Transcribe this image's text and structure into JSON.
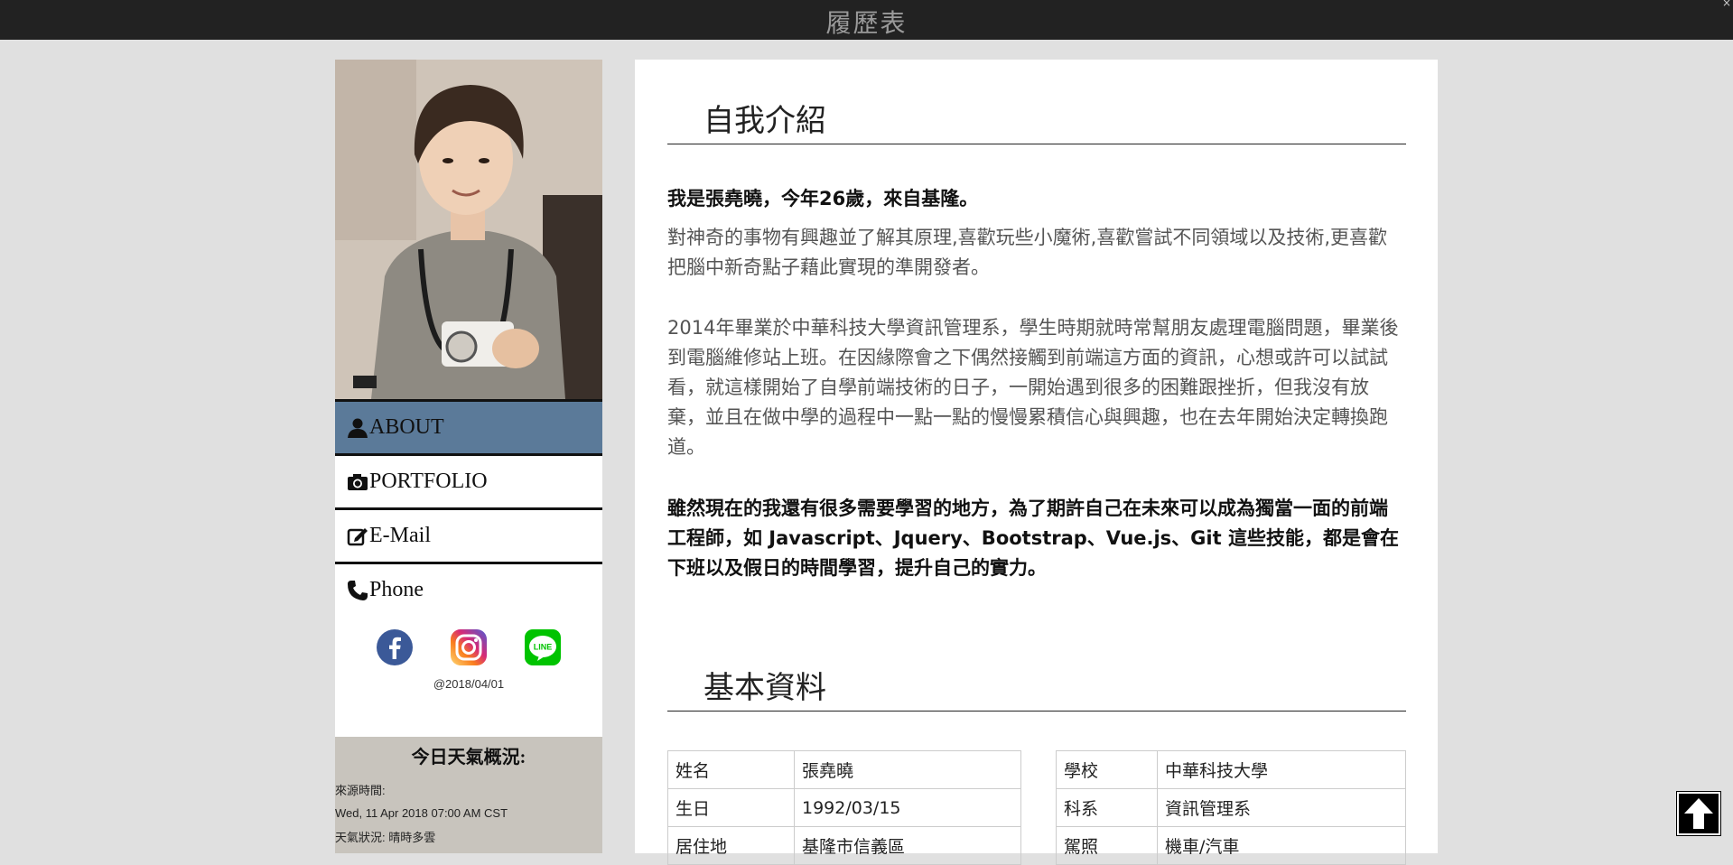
{
  "header": {
    "title": "履歷表",
    "close_glyph": "×"
  },
  "sidebar": {
    "nav": [
      {
        "label": "ABOUT",
        "icon": "user-icon"
      },
      {
        "label": "PORTFOLIO",
        "icon": "camera-icon"
      },
      {
        "label": "E-Mail",
        "icon": "edit-icon"
      },
      {
        "label": "Phone",
        "icon": "phone-icon"
      }
    ],
    "social": [
      "facebook-icon",
      "instagram-icon",
      "line-icon"
    ],
    "line_logo_text": "LINE",
    "date": "@2018/04/01",
    "weather": {
      "title": "今日天氣概況:",
      "source_label": "來源時間:",
      "source_time": "Wed, 11 Apr 2018 07:00 AM CST",
      "condition": "天氣狀況: 晴時多雲"
    }
  },
  "main": {
    "about": {
      "title": "自我介紹",
      "intro": "我是張堯曉，今年26歲，來自基隆。",
      "p1": "對神奇的事物有興趣並了解其原理,喜歡玩些小魔術,喜歡嘗試不同領域以及技術,更喜歡把腦中新奇點子藉此實現的準開發者。",
      "p2": "2014年畢業於中華科技大學資訊管理系，學生時期就時常幫朋友處理電腦問題，畢業後到電腦維修站上班。在因緣際會之下偶然接觸到前端這方面的資訊，心想或許可以試試看，就這樣開始了自學前端技術的日子，一開始遇到很多的困難跟挫折，但我沒有放棄，並且在做中學的過程中一點一點的慢慢累積信心與興趣，也在去年開始決定轉換跑道。",
      "p3": "雖然現在的我還有很多需要學習的地方，為了期許自己在未來可以成為獨當一面的前端工程師，如 Javascript、Jquery、Bootstrap、Vue.js、Git 這些技能，都是會在下班以及假日的時間學習，提升自己的實力。"
    },
    "basic": {
      "title": "基本資料",
      "left": [
        {
          "k": "姓名",
          "v": "張堯曉"
        },
        {
          "k": "生日",
          "v": "1992/03/15"
        },
        {
          "k": "居住地",
          "v": "基隆市信義區"
        }
      ],
      "right": [
        {
          "k": "學校",
          "v": "中華科技大學"
        },
        {
          "k": "科系",
          "v": "資訊管理系"
        },
        {
          "k": "駕照",
          "v": "機車/汽車"
        }
      ]
    }
  },
  "colors": {
    "nav_active": "#5b7a99",
    "topbar": "#222222",
    "background": "#e0e0e0"
  }
}
